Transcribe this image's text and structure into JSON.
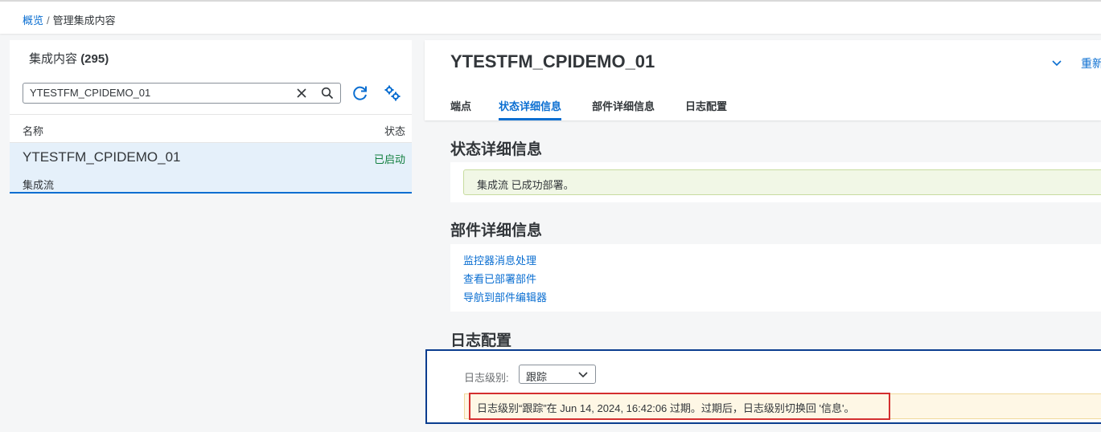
{
  "breadcrumb": {
    "overview": "概览",
    "separator": "/",
    "current": "管理集成内容"
  },
  "left": {
    "title": "集成内容",
    "count": "(295)",
    "search": {
      "value": "YTESTFM_CPIDEMO_01",
      "placeholder": ""
    },
    "columns": {
      "name": "名称",
      "status": "状态"
    },
    "items": [
      {
        "name": "YTESTFM_CPIDEMO_01",
        "status": "已启动",
        "type": "集成流"
      }
    ]
  },
  "detail": {
    "title": "YTESTFM_CPIDEMO_01",
    "redeploy": "重新",
    "tabs": [
      {
        "label": "端点"
      },
      {
        "label": "状态详细信息"
      },
      {
        "label": "部件详细信息"
      },
      {
        "label": "日志配置"
      }
    ],
    "status_section": {
      "title": "状态详细信息",
      "message": "集成流 已成功部署。"
    },
    "artifact_section": {
      "title": "部件详细信息",
      "links": [
        "监控器消息处理",
        "查看已部署部件",
        "导航到部件编辑器"
      ]
    },
    "log_section": {
      "title": "日志配置",
      "level_label": "日志级别:",
      "level_value": "跟踪",
      "warning": "日志级别“跟踪”在 Jun 14, 2024, 16:42:06 过期。过期后，日志级别切换回 '信息'。"
    }
  },
  "colors": {
    "accent": "#0a6ed1",
    "success": "#107e3e",
    "highlight_border": "#d32f2f"
  }
}
